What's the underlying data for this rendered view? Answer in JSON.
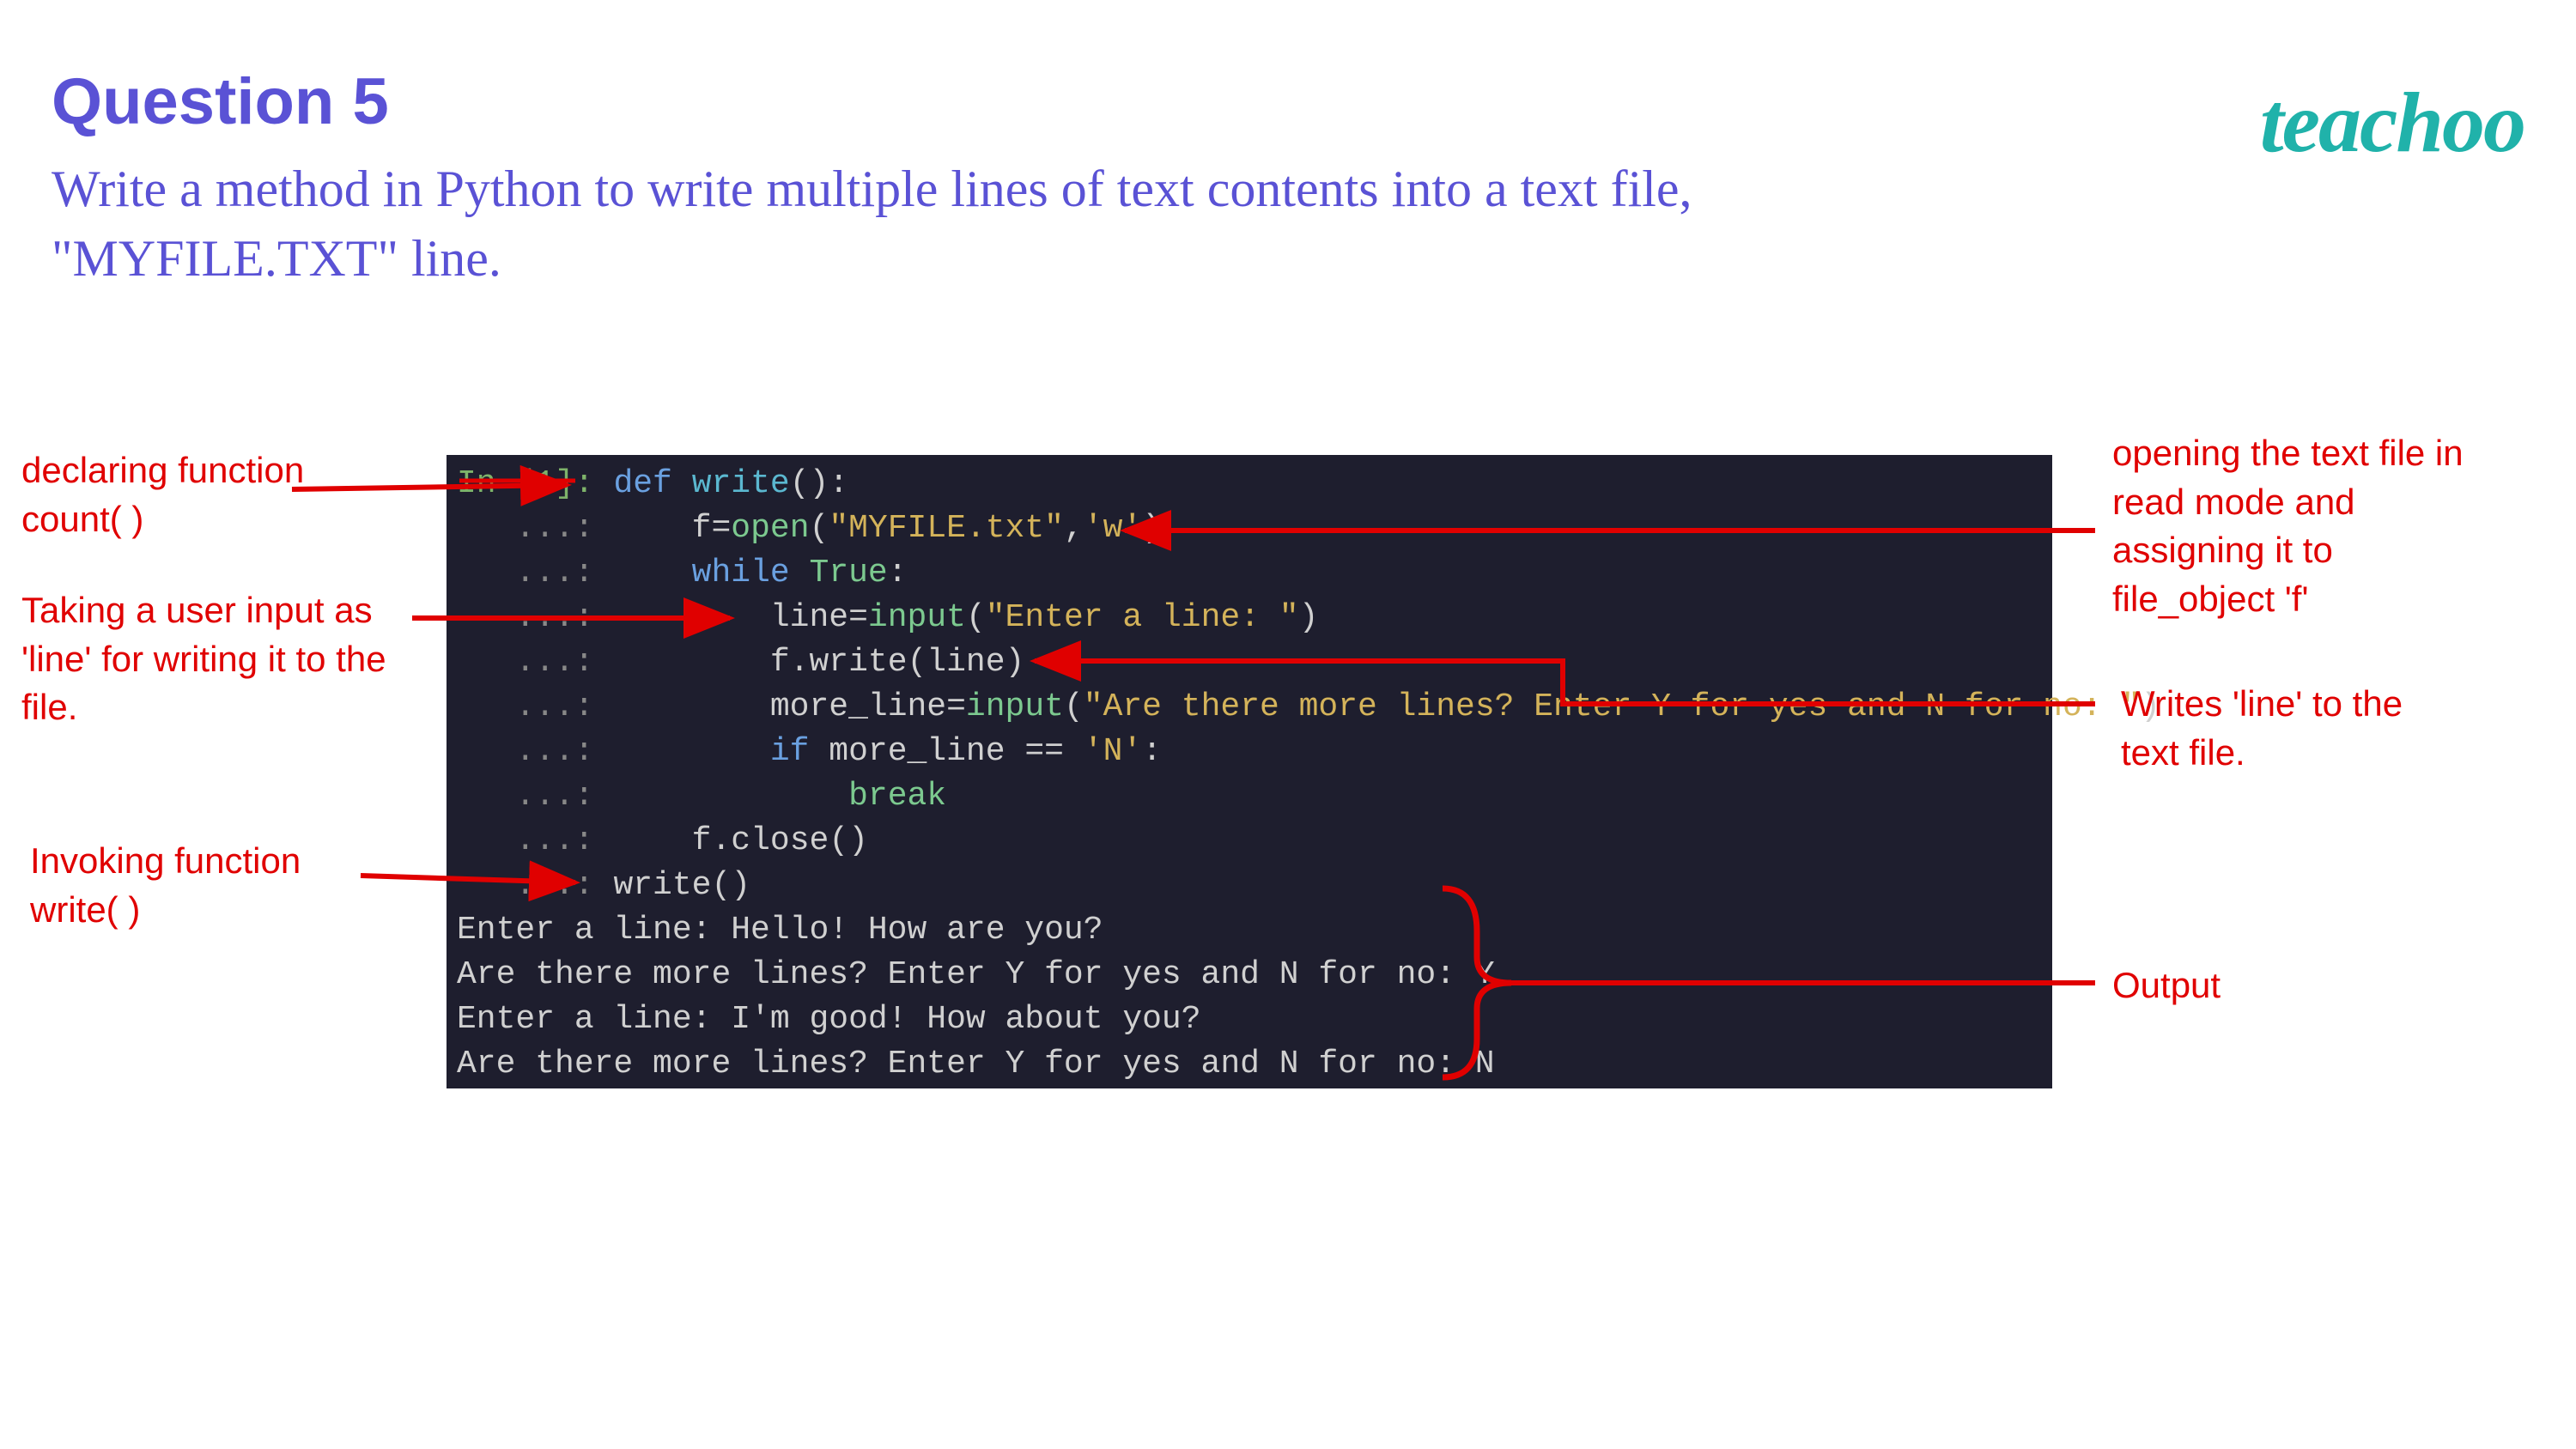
{
  "header": {
    "title": "Question 5",
    "logo": "teachoo",
    "text": "Write a method in Python to write multiple lines  of text contents into a text file, \"MYFILE.TXT\" line."
  },
  "annotations": {
    "declare": "declaring function count( )",
    "input": "Taking a user input as 'line' for writing it to the file.",
    "invoke": "Invoking function write( )",
    "open": "opening the text file in read mode and assigning it to file_object 'f'",
    "write": "Writes 'line' to the text file.",
    "output": "Output"
  },
  "code": {
    "prompt_in": "In [1]:",
    "prompt_cont": "...:",
    "l1_def": "def",
    "l1_name": "write",
    "l1_open": "():",
    "l2_f": "f",
    "l2_eq": "=",
    "l2_open": "open",
    "l2_args": "(\"MYFILE.txt\",'w')",
    "l2_str1": "\"MYFILE.txt\"",
    "l2_comma": ",",
    "l2_str2": "'w'",
    "l3_while": "while",
    "l3_true": "True",
    "l3_colon": ":",
    "l4_line": "line",
    "l4_eq": "=",
    "l4_input": "input",
    "l4_str": "\"Enter a line: \"",
    "l5_fwrite": "f.write(line)",
    "l5_f": "f",
    "l5_write": ".write",
    "l5_arg": "(line)",
    "l6_more": "more_line",
    "l6_eq": "=",
    "l6_input": "input",
    "l6_str": "\"Are there more lines? Enter Y for yes and N for no: \"",
    "l7_if": "if",
    "l7_more": "more_line",
    "l7_eqeq": "==",
    "l7_str": "'N'",
    "l7_colon": ":",
    "l8_break": "break",
    "l9_f": "f",
    "l9_close": ".close",
    "l9_p": "()",
    "l10_call": "write()",
    "out1": "Enter a line: Hello! How are you?",
    "out2": "Are there more lines? Enter Y for yes and N for no: Y",
    "out3": "Enter a line: I'm good! How about you?",
    "out4": "Are there more lines? Enter Y for yes and N for no: N"
  },
  "colors": {
    "annotation": "#e00000",
    "heading": "#5a52d5",
    "brand": "#20b2aa",
    "code_bg": "#1e1e2e"
  }
}
